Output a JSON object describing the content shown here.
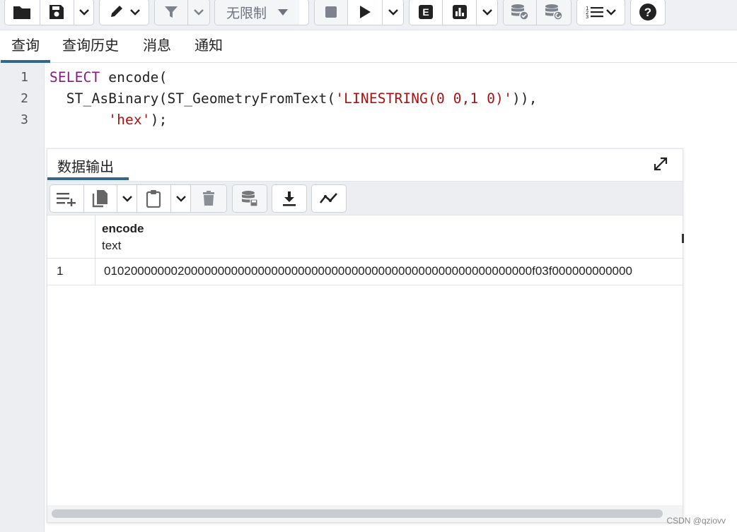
{
  "toolbar": {
    "limit_select_value": "无限制"
  },
  "tabs": [
    {
      "label": "查询",
      "active": true
    },
    {
      "label": "查询历史",
      "active": false
    },
    {
      "label": "消息",
      "active": false
    },
    {
      "label": "通知",
      "active": false
    }
  ],
  "editor": {
    "line_numbers": [
      "1",
      "2",
      "3"
    ],
    "lines": [
      [
        {
          "t": "SELECT",
          "c": "kw"
        },
        {
          "t": " encode(",
          "c": ""
        }
      ],
      [
        {
          "t": "  ST_AsBinary(ST_GeometryFromText(",
          "c": ""
        },
        {
          "t": "'LINESTRING(0 0,1 0)'",
          "c": "str"
        },
        {
          "t": ")),",
          "c": ""
        }
      ],
      [
        {
          "t": "       ",
          "c": ""
        },
        {
          "t": "'hex'",
          "c": "str"
        },
        {
          "t": ");",
          "c": ""
        }
      ]
    ]
  },
  "output_panel": {
    "title": "数据输出",
    "columns": [
      {
        "name": "encode",
        "type": "text"
      }
    ],
    "rows": [
      {
        "row_number": "1",
        "encode": "0102000000020000000000000000000000000000000000000000000000000000f03f000000000000"
      }
    ]
  },
  "watermark": "CSDN @qziovv",
  "colors": {
    "keyword": "#8a1a83",
    "string": "#aa1111",
    "accent": "#326690"
  }
}
